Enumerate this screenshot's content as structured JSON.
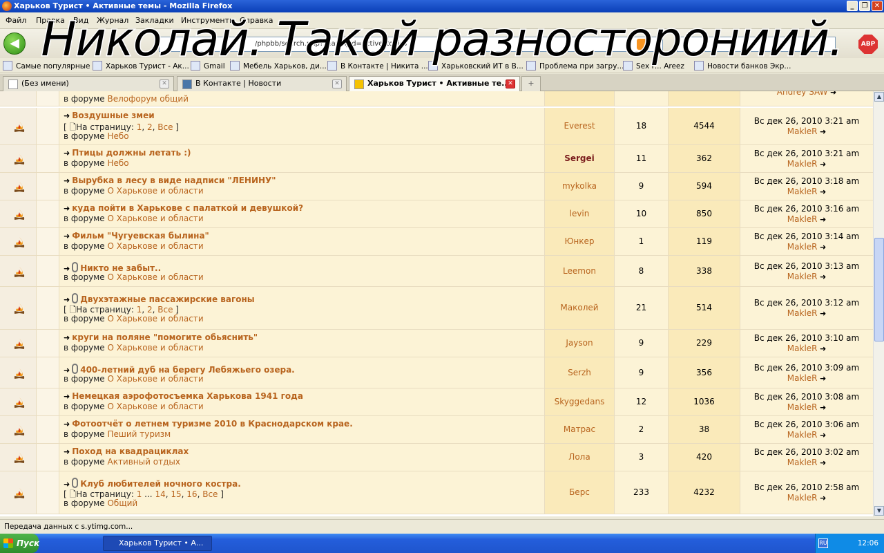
{
  "window": {
    "title": "Харьков Турист • Активные темы - Mozilla Firefox"
  },
  "menu": [
    "Файл",
    "Правка",
    "Вид",
    "Журнал",
    "Закладки",
    "Инструменты",
    "Справка"
  ],
  "navbar": {
    "url": "/phpbb/search.php?search_id=active_topics"
  },
  "bookmarks": [
    "Самые популярные",
    "Харьков Турист - Ак...",
    "Gmail",
    "Мебель Харьков, ди...",
    "В Контакте | Никита ...",
    "Харьковский ИТ в В...",
    "Проблема при загру...",
    "Sex F... Areez",
    "Новости банков Экр..."
  ],
  "tabs": [
    {
      "label": "(Без имени)"
    },
    {
      "label": "В Контакте | Новости"
    },
    {
      "label": "Харьков Турист • Активные те..."
    }
  ],
  "overlay_text": "Николай. Такой разносторониий.",
  "partial_top": {
    "forum_prefix": "в форуме",
    "forum": "Велофорум общий",
    "last_user": "Andrey SAW"
  },
  "labels": {
    "in_forum": "в форуме",
    "pages": "На страницу:"
  },
  "topics": [
    {
      "title": "Воздушные змеи",
      "pages": [
        "1",
        "2",
        "Все"
      ],
      "forum": "Небо",
      "author": "Everest",
      "replies": "18",
      "views": "4544",
      "last_date": "Вс дек 26, 2010 3:21 am",
      "last_user": "MakleR",
      "clip": false
    },
    {
      "title": "Птицы должны летать :)",
      "pages": null,
      "forum": "Небо",
      "author": "Sergei",
      "author_strong": true,
      "replies": "11",
      "views": "362",
      "last_date": "Вс дек 26, 2010 3:21 am",
      "last_user": "MakleR",
      "clip": false
    },
    {
      "title": "Вырубка в лесу в виде надписи \"ЛЕНИНУ\"",
      "pages": null,
      "forum": "О Харькове и области",
      "author": "mykolka",
      "replies": "9",
      "views": "594",
      "last_date": "Вс дек 26, 2010 3:18 am",
      "last_user": "MakleR",
      "clip": false
    },
    {
      "title": "куда пойти в Харькове с палаткой и девушкой?",
      "pages": null,
      "forum": "О Харькове и области",
      "author": "levin",
      "replies": "10",
      "views": "850",
      "last_date": "Вс дек 26, 2010 3:16 am",
      "last_user": "MakleR",
      "clip": false
    },
    {
      "title": "Фильм \"Чугуевская былина\"",
      "pages": null,
      "forum": "О Харькове и области",
      "author": "Юнкер",
      "replies": "1",
      "views": "119",
      "last_date": "Вс дек 26, 2010 3:14 am",
      "last_user": "MakleR",
      "clip": false
    },
    {
      "title": "Никто не забыт..",
      "pages": null,
      "forum": "О Харькове и области",
      "author": "Leemon",
      "replies": "8",
      "views": "338",
      "last_date": "Вс дек 26, 2010 3:13 am",
      "last_user": "MakleR",
      "clip": true
    },
    {
      "title": "Двухэтажные пассажирские вагоны",
      "pages": [
        "1",
        "2",
        "Все"
      ],
      "forum": "О Харькове и области",
      "author": "Маколей",
      "replies": "21",
      "views": "514",
      "last_date": "Вс дек 26, 2010 3:12 am",
      "last_user": "MakleR",
      "clip": true
    },
    {
      "title": "круги на поляне \"помогите обьяснить\"",
      "pages": null,
      "forum": "О Харькове и области",
      "author": "Jayson",
      "replies": "9",
      "views": "229",
      "last_date": "Вс дек 26, 2010 3:10 am",
      "last_user": "MakleR",
      "clip": false
    },
    {
      "title": "400-летний дуб на берегу Лебяжьего озера.",
      "pages": null,
      "forum": "О Харькове и области",
      "author": "Serzh",
      "replies": "9",
      "views": "356",
      "last_date": "Вс дек 26, 2010 3:09 am",
      "last_user": "MakleR",
      "clip": true
    },
    {
      "title": "Немецкая аэрофотосъемка Харькова 1941 года",
      "pages": null,
      "forum": "О Харькове и области",
      "author": "Skyggedans",
      "replies": "12",
      "views": "1036",
      "last_date": "Вс дек 26, 2010 3:08 am",
      "last_user": "MakleR",
      "clip": false
    },
    {
      "title": "Фотоотчёт о летнем туризме 2010 в Краснодарском крае.",
      "pages": null,
      "forum": "Пеший туризм",
      "author": "Матрас",
      "replies": "2",
      "views": "38",
      "last_date": "Вс дек 26, 2010 3:06 am",
      "last_user": "MakleR",
      "clip": false
    },
    {
      "title": "Поход на квадрациклах",
      "pages": null,
      "forum": "Активный отдых",
      "author": "Лола",
      "replies": "3",
      "views": "420",
      "last_date": "Вс дек 26, 2010 3:02 am",
      "last_user": "MakleR",
      "clip": false
    },
    {
      "title": "Клуб любителей ночного костра.",
      "pages": [
        "1",
        "...",
        "14",
        "15",
        "16",
        "Все"
      ],
      "forum": "Общий",
      "author": "Берс",
      "replies": "233",
      "views": "4232",
      "last_date": "Вс дек 26, 2010 2:58 am",
      "last_user": "MakleR",
      "clip": true
    }
  ],
  "status": {
    "text": "Передача данных с s.ytimg.com..."
  },
  "taskbar": {
    "start": "Пуск",
    "item": "Харьков Турист • А...",
    "lang": "RU",
    "clock": "12:06"
  }
}
